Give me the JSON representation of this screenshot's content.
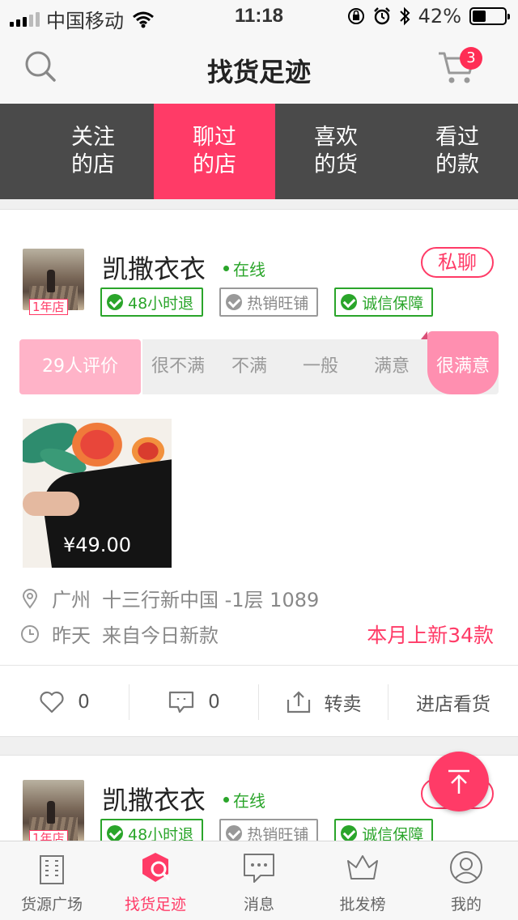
{
  "status": {
    "carrier": "中国移动",
    "time": "11:18",
    "battery": "42%",
    "battery_level": 0.42
  },
  "nav": {
    "title": "找货足迹",
    "cart_count": "3"
  },
  "tabs": [
    {
      "line1": "关注",
      "line2": "的店"
    },
    {
      "line1": "聊过",
      "line2": "的店"
    },
    {
      "line1": "喜欢",
      "line2": "的货"
    },
    {
      "line1": "看过",
      "line2": "的款"
    }
  ],
  "shop": {
    "name": "凯撒衣衣",
    "status": "在线",
    "years_badge": "1年店",
    "chat_label": "私聊",
    "badges": [
      "48小时退",
      "热销旺铺",
      "诚信保障"
    ],
    "rating_count": "29人评价",
    "rating_options": [
      "很不满",
      "不满",
      "一般",
      "满意",
      "很满意"
    ],
    "product_price": "¥49.00",
    "city": "广州",
    "address": "十三行新中国 -1层 1089",
    "time_label": "昨天",
    "source": "来自今日新款",
    "new_this_month": "本月上新34款",
    "likes": "0",
    "comments": "0",
    "resell_label": "转卖",
    "visit_label": "进店看货"
  },
  "colors": {
    "accent": "#ff3b67",
    "tabs_bg": "#4a4a4a",
    "online_green": "#2aa52a"
  },
  "tabbar": [
    {
      "label": "货源广场",
      "icon": "building-icon"
    },
    {
      "label": "找货足迹",
      "icon": "footprint-search-icon"
    },
    {
      "label": "消息",
      "icon": "message-icon"
    },
    {
      "label": "批发榜",
      "icon": "crown-icon"
    },
    {
      "label": "我的",
      "icon": "user-icon"
    }
  ]
}
